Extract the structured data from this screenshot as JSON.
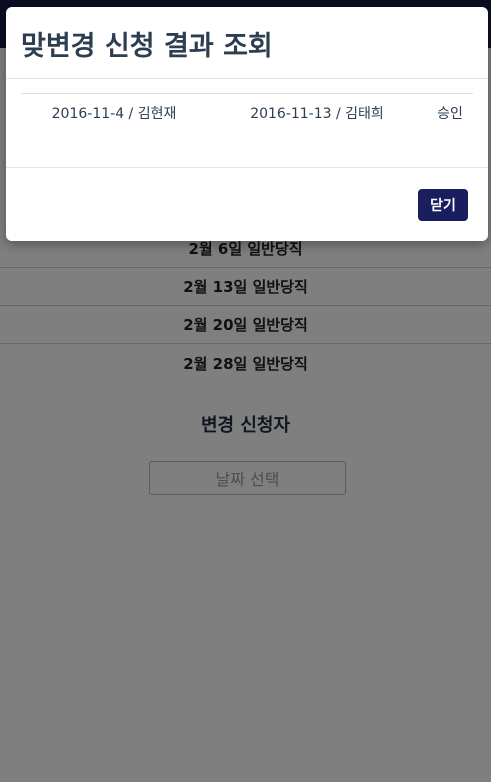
{
  "background": {
    "schedule_rows": [
      "2월 6일 일반당직",
      "2월 13일 일반당직",
      "2월 20일 일반당직",
      "2월 28일 일반당직"
    ],
    "requester_heading": "변경 신청자",
    "date_select_placeholder": "날짜 선택"
  },
  "modal": {
    "title": "맞변경 신청 결과 조회",
    "results": [
      {
        "my_duty": "2016-11-4 / 김현재",
        "target_duty": "2016-11-13 / 김태희",
        "status": "승인"
      }
    ],
    "close_label": "닫기"
  }
}
